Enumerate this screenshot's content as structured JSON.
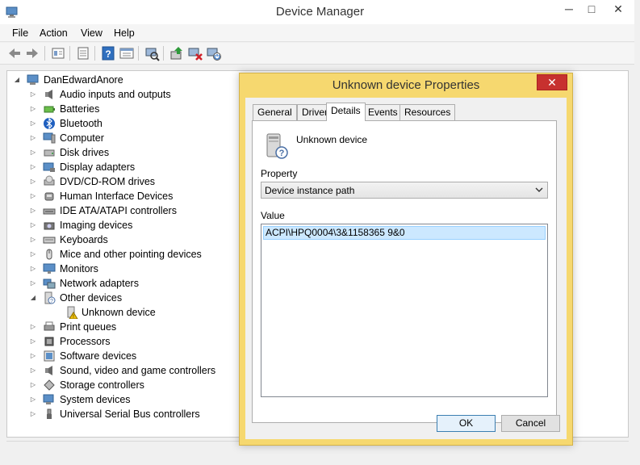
{
  "window": {
    "title": "Device Manager",
    "min_glyph": "─",
    "max_glyph": "□",
    "close_glyph": "✕"
  },
  "menu": [
    "File",
    "Action",
    "View",
    "Help"
  ],
  "toolbar": {
    "buttons": [
      "back-icon",
      "forward-icon",
      "properties-icon",
      "show-hidden-icon",
      "help-icon",
      "view-resources-icon",
      "scan-hardware-icon",
      "update-driver-icon",
      "uninstall-icon",
      "enable-device-icon"
    ]
  },
  "tree": {
    "root": "DanEdwardAnore",
    "items": [
      {
        "label": "Audio inputs and outputs",
        "icon": "speaker-icon"
      },
      {
        "label": "Batteries",
        "icon": "battery-icon"
      },
      {
        "label": "Bluetooth",
        "icon": "bluetooth-icon"
      },
      {
        "label": "Computer",
        "icon": "computer-icon"
      },
      {
        "label": "Disk drives",
        "icon": "disk-icon"
      },
      {
        "label": "Display adapters",
        "icon": "display-adapter-icon"
      },
      {
        "label": "DVD/CD-ROM drives",
        "icon": "dvd-icon"
      },
      {
        "label": "Human Interface Devices",
        "icon": "hid-icon"
      },
      {
        "label": "IDE ATA/ATAPI controllers",
        "icon": "ide-icon"
      },
      {
        "label": "Imaging devices",
        "icon": "camera-icon"
      },
      {
        "label": "Keyboards",
        "icon": "keyboard-icon"
      },
      {
        "label": "Mice and other pointing devices",
        "icon": "mouse-icon"
      },
      {
        "label": "Monitors",
        "icon": "monitor-icon"
      },
      {
        "label": "Network adapters",
        "icon": "network-icon"
      },
      {
        "label": "Other devices",
        "icon": "unknown-device-icon",
        "expanded": true
      },
      {
        "label": "Unknown device",
        "icon": "warning-device-icon",
        "child": true
      },
      {
        "label": "Print queues",
        "icon": "printer-icon"
      },
      {
        "label": "Processors",
        "icon": "processor-icon"
      },
      {
        "label": "Software devices",
        "icon": "software-icon"
      },
      {
        "label": "Sound, video and game controllers",
        "icon": "sound-icon"
      },
      {
        "label": "Storage controllers",
        "icon": "storage-icon"
      },
      {
        "label": "System devices",
        "icon": "system-icon"
      },
      {
        "label": "Universal Serial Bus controllers",
        "icon": "usb-icon"
      }
    ]
  },
  "dialog": {
    "title": "Unknown device Properties",
    "close_glyph": "✕",
    "tabs": [
      "General",
      "Driver",
      "Details",
      "Events",
      "Resources"
    ],
    "active_tab": "Details",
    "device_name": "Unknown device",
    "property_label": "Property",
    "property_selected": "Device instance path",
    "value_label": "Value",
    "value": "ACPI\\HPQ0004\\3&1158365 9&0",
    "ok_label": "OK",
    "cancel_label": "Cancel"
  }
}
